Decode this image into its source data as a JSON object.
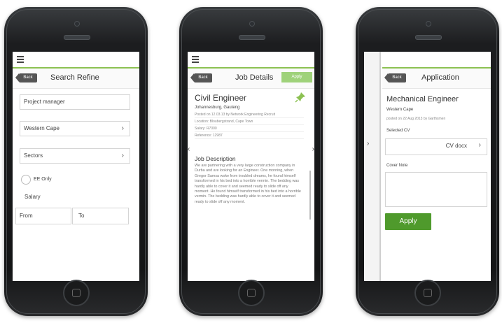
{
  "screen1": {
    "menu_icon": "hamburger-icon",
    "back_label": "Back",
    "title": "Search Refine",
    "keyword_value": "Project manager",
    "region_value": "Western Cape",
    "sectors_value": "Sectors",
    "ee_only_label": "EE Only",
    "salary_label": "Salary",
    "from_placeholder": "From",
    "to_placeholder": "To"
  },
  "screen2": {
    "menu_icon": "hamburger-icon",
    "back_label": "Back",
    "title": "Job Details",
    "apply_label": "Apply",
    "job_title": "Civil Engineer",
    "location": "Johannesburg, Gauteng",
    "posted": "Posted on 12.03.13 by Network Engineering Recruit",
    "location_line": "Location: Bloubergstrand, Cape Town",
    "salary_line": "Salary: R7000",
    "reference_line": "Reference: 12987",
    "section_heading": "Job Description",
    "description": "We are partnering with a very large construction company in Durba and are looking for an Engineer. One morning, when Gregor Samsa woke from troubled dreams, he found himself transformed in his bed into a horrible vermin. The bedding was hardly able to cover it and seemed ready to slide off any moment. He found himself transformed in his bed into a horrible vermin. The bedding was hardly able to cover it and seemed ready to slide off any moment."
  },
  "screen3": {
    "back_label": "Back",
    "title": "Application",
    "job_title": "Mechanical Engineer",
    "location": "Western Cape",
    "posted": "posted on 22 Aug 2013 by Garthsmen",
    "selected_cv_label": "Selected CV",
    "cv_value": "CV docx",
    "cover_note_label": "Cover Note",
    "apply_label": "Apply"
  },
  "colors": {
    "accent_green": "#8cc152",
    "apply_button_green": "#4f9a2c"
  }
}
